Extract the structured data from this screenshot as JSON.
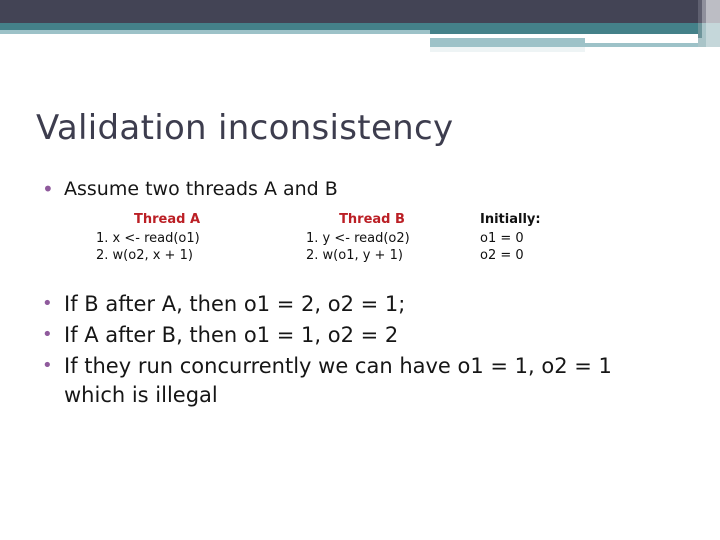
{
  "slide": {
    "title": "Validation inconsistency",
    "bullet_marker": "•",
    "intro_bullet": "Assume two threads A and B",
    "colors": {
      "title": "#3d3d4e",
      "bullet_marker": "#8f5a9c",
      "thread_heading": "#bb1f25",
      "body_text": "#161616",
      "band_dark": "#434455",
      "band_teal": "#448189",
      "band_light_teal": "#9dc2c8"
    },
    "thread_table": {
      "columns": [
        {
          "heading": "Thread A",
          "steps": [
            "1. x <- read(o1)",
            "2. w(o2, x + 1)"
          ]
        },
        {
          "heading": "Thread B",
          "steps": [
            "1. y <- read(o2)",
            "2. w(o1, y + 1)"
          ]
        },
        {
          "heading": "Initially:",
          "steps": [
            "o1 = 0",
            "o2 = 0"
          ]
        }
      ]
    },
    "conclusions": [
      "If B after A, then o1 = 2, o2 = 1;",
      "If A after B, then o1 = 1, o2 = 2",
      "If they run concurrently we can have o1 = 1, o2 = 1 which is illegal"
    ]
  }
}
